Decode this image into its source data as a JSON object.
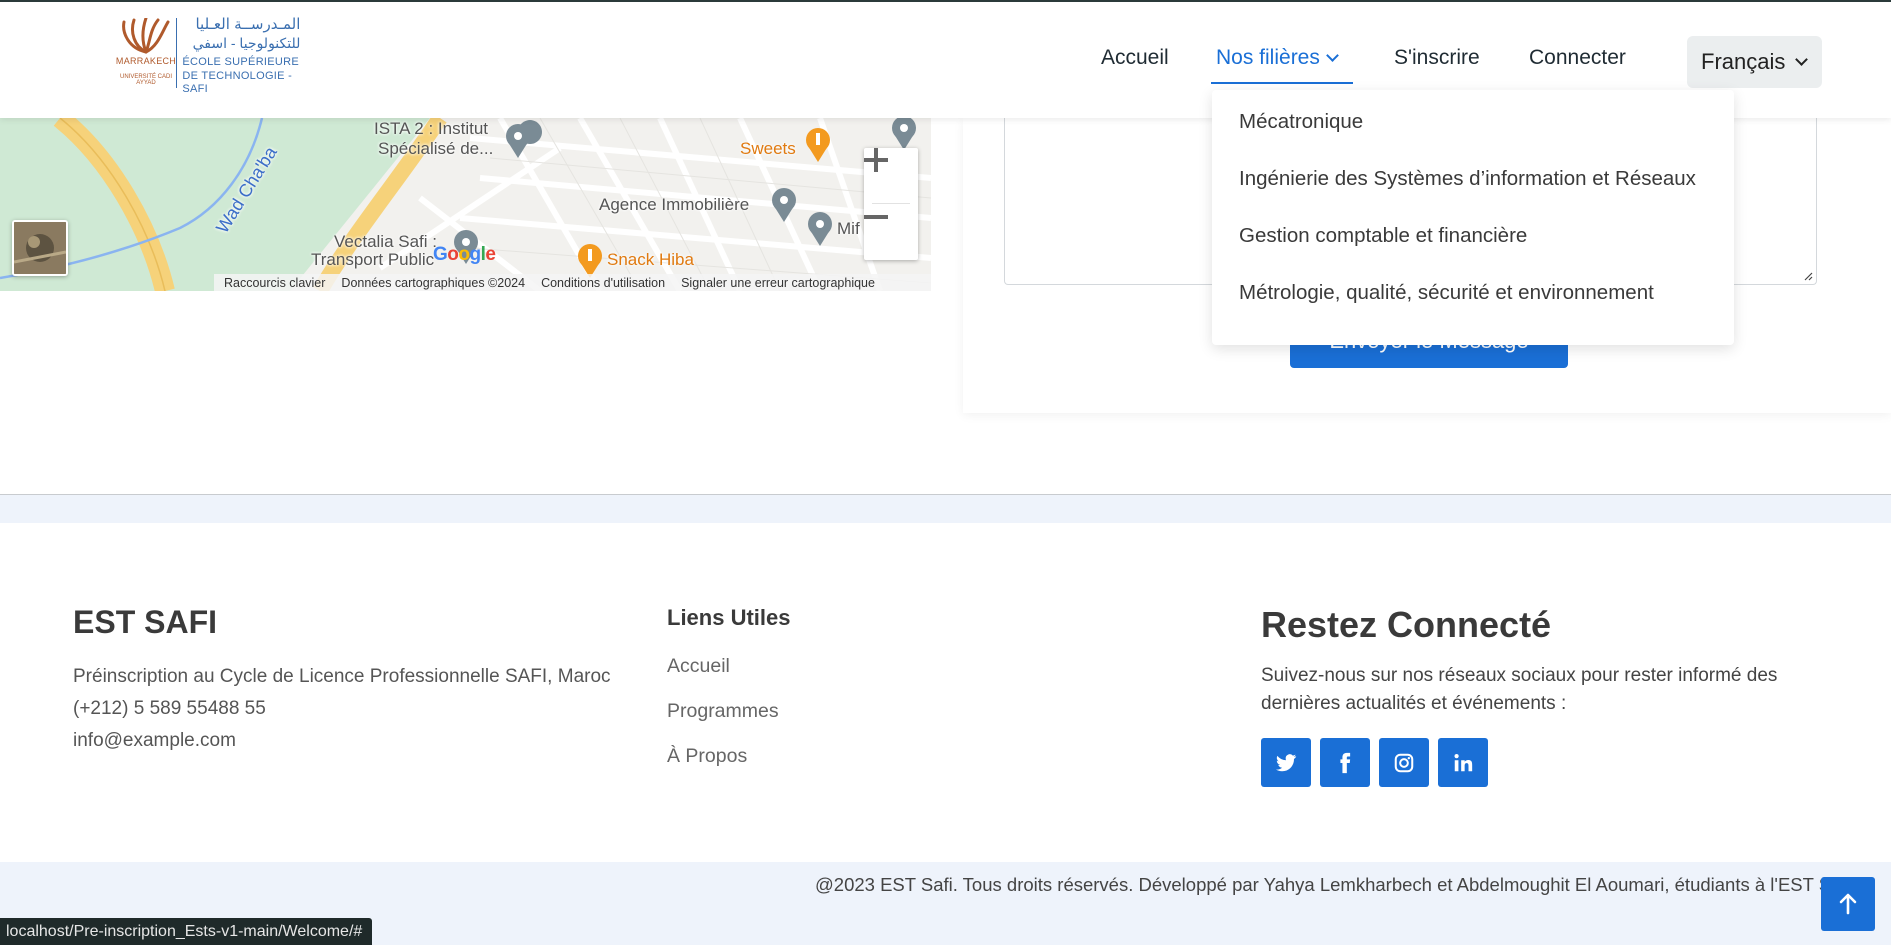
{
  "header": {
    "logo": {
      "arabic_line1": "المـدرســة العـليا",
      "arabic_line2": "للتكنولوجيا - اسفي",
      "french_line1": "ÉCOLE  SUPÉRIEURE",
      "french_line2": "DE TECHNOLOGIE -SAFI",
      "city": "MARRAKECH",
      "university": "UNIVERSITÉ CADI AYYAD"
    },
    "nav": {
      "home": "Accueil",
      "programs": "Nos filières",
      "register": "S'inscrire",
      "login": "Connecter"
    },
    "language": {
      "selected": "Français"
    },
    "dropdown": [
      "Mécatronique",
      "Ingénierie des Systèmes d’information et Réseaux",
      "Gestion comptable et financière",
      "Métrologie, qualité, sécurité et environnement"
    ]
  },
  "map": {
    "labels": {
      "ista": "ISTA 2 : Institut",
      "ista2": "Spécialisé de...",
      "sweets": "Sweets",
      "agence": "Agence Immobilière",
      "mif": "Mif",
      "vectalia": "Vectalia Safi :",
      "vectalia2": "Transport Public",
      "snack": "Snack Hiba",
      "wad": "Wad Cha'ba"
    },
    "footer": {
      "shortcuts": "Raccourcis clavier",
      "mapdata": "Données cartographiques ©2024",
      "terms": "Conditions d'utilisation",
      "report": "Signaler une erreur cartographique"
    },
    "google": "Google"
  },
  "form": {
    "send_label": "Envoyer le Message"
  },
  "footer": {
    "brand": "EST SAFI",
    "address": "Préinscription au Cycle de Licence Professionnelle SAFI, Maroc",
    "phone": "(+212) 5 589 55488 55",
    "email": "info@example.com",
    "links_title": "Liens Utiles",
    "links": [
      "Accueil",
      "Programmes",
      "À Propos"
    ],
    "connect_title": "Restez Connecté",
    "connect_desc": "Suivez-nous sur nos réseaux sociaux pour rester informé des dernières actualités et événements :",
    "social": [
      "twitter-icon",
      "facebook-icon",
      "instagram-icon",
      "linkedin-icon"
    ],
    "copyright": "@2023 EST Safi. Tous droits réservés. Développé par Yahya Lemkharbech et Abdelmoughit El Aoumari, étudiants à l'EST Safi."
  },
  "status_bar": {
    "url": "localhost/Pre-inscription_Ests-v1-main/Welcome/#"
  },
  "colors": {
    "primary": "#1a6fd6",
    "footer_bg": "#eef3fb",
    "logo_blue": "#3a6fb0",
    "logo_brown": "#b05a2c"
  }
}
